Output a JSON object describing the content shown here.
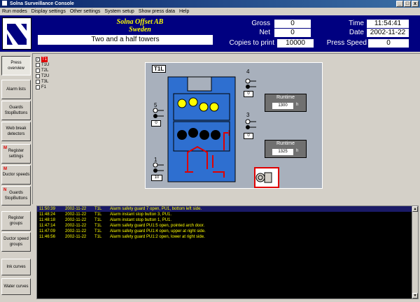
{
  "window": {
    "title": "Solna Surveillance Console",
    "min": "_",
    "max": "□",
    "close": "x"
  },
  "menu": [
    "Run modes",
    "Display settings",
    "Other settings",
    "System setup",
    "Show press data",
    "Help"
  ],
  "header": {
    "company_line1": "Solna Offset AB",
    "company_line2": "Sweden",
    "press_name": "Two and a half towers",
    "gross_label": "Gross",
    "gross_value": "0",
    "net_label": "Net",
    "net_value": "0",
    "copies_label": "Copies to print",
    "copies_value": "10000",
    "time_label": "Time",
    "time_value": "11:54:41",
    "date_label": "Date",
    "date_value": "2002-11-22",
    "speed_label": "Press Speed",
    "speed_value": "0"
  },
  "sidebar": [
    {
      "label": "Press overview",
      "active": true,
      "mark": ""
    },
    {
      "label": "Alarm lists",
      "mark": ""
    },
    {
      "label": "Guards StopButtons",
      "mark": ""
    },
    {
      "label": "Web break detectors",
      "mark": ""
    },
    {
      "label": "Register settings",
      "mark": "M"
    },
    {
      "label": "Ductor speeds",
      "mark": "M"
    },
    {
      "label": "Guards StopButtons",
      "mark": "N"
    },
    {
      "label": "Register groups",
      "mark": ""
    },
    {
      "label": "Ductor speed groups",
      "mark": ""
    },
    {
      "label": "Ink curves",
      "mark": ""
    },
    {
      "label": "Water curves",
      "mark": ""
    }
  ],
  "tree": [
    {
      "label": "T1",
      "checked": true,
      "selected": true
    },
    {
      "label": "T1U",
      "checked": false
    },
    {
      "label": "T2L",
      "checked": false
    },
    {
      "label": "T2U",
      "checked": false
    },
    {
      "label": "T3L",
      "checked": false
    },
    {
      "label": "F1",
      "checked": false
    }
  ],
  "press": {
    "tower_label": "T1L",
    "unit_labels": {
      "u4": "4",
      "u5": "5",
      "u3": "3",
      "u1": "1"
    },
    "counters": {
      "u4": "0",
      "u5": "0",
      "u3": "0",
      "u1": "10"
    },
    "runtime_top": {
      "label": "Runtime",
      "value": "1300",
      "unit": "h"
    },
    "runtime_bottom": {
      "label": "Runtime",
      "value": "1325",
      "unit": "h"
    },
    "colors": {
      "tower": "#2e6fd0",
      "yellow_roll": "#ffff00",
      "black_roll": "#000000",
      "web": "#e00000",
      "panel": "#a8b0bc"
    }
  },
  "log": [
    {
      "time": "11:50:39",
      "date": "2002-11-22",
      "tower": "T1L",
      "text": "Alarm safety guard 7 open, PU1, bottom left side."
    },
    {
      "time": "11:48:24",
      "date": "2002-11-22",
      "tower": "T1L",
      "text": "Alarm instant stop button 3, PU1."
    },
    {
      "time": "11:48:18",
      "date": "2002-11-22",
      "tower": "T1L",
      "text": "Alarm instant stop button 1, PU1."
    },
    {
      "time": "11:47:14",
      "date": "2002-11-22",
      "tower": "T1L",
      "text": "Alarm safety guard PU1:5 open, pointed arch door."
    },
    {
      "time": "11:47:09",
      "date": "2002-11-22",
      "tower": "T1L",
      "text": "Alarm safety guard PU1:4 open, upper at right side."
    },
    {
      "time": "11:46:56",
      "date": "2002-11-22",
      "tower": "T1L",
      "text": "Alarm safety guard PU1:2 open, lower at right side."
    }
  ]
}
